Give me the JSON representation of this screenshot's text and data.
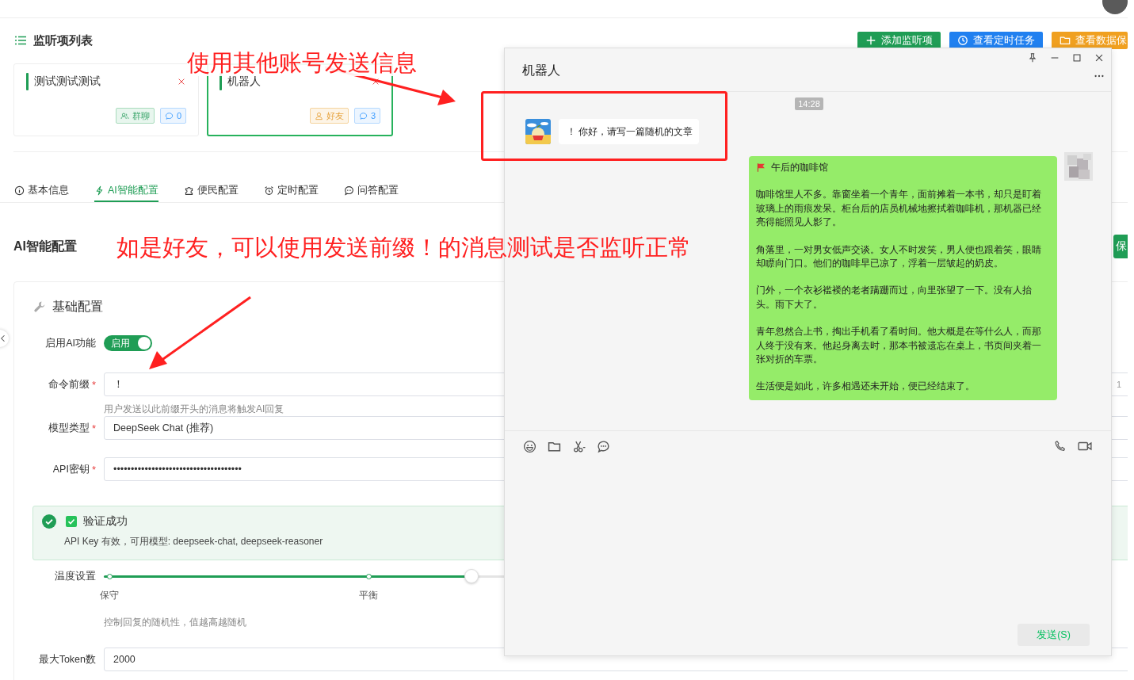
{
  "page": {
    "title": "监听项列表",
    "actions": [
      {
        "label": "添加监听项",
        "kind": "add"
      },
      {
        "label": "查看定时任务",
        "kind": "clock"
      },
      {
        "label": "查看数据保",
        "kind": "folder"
      }
    ],
    "monitor_items": [
      {
        "title": "测试测试测试",
        "selected": false,
        "kind": "group",
        "type_label": "群聊",
        "count": "0"
      },
      {
        "title": "机器人",
        "selected": true,
        "kind": "friend",
        "type_label": "好友",
        "count": "3"
      }
    ],
    "tabs": [
      {
        "label": "基本信息",
        "kind": "info",
        "selected": false
      },
      {
        "label": "AI智能配置",
        "kind": "bolt",
        "selected": true
      },
      {
        "label": "便民配置",
        "kind": "puzzle",
        "selected": false
      },
      {
        "label": "定时配置",
        "kind": "alarm",
        "selected": false
      },
      {
        "label": "问答配置",
        "kind": "chat",
        "selected": false
      }
    ],
    "section_title": "AI智能配置",
    "save_button": "保",
    "panel": {
      "title": "基础配置",
      "fields": [
        {
          "kind": "switch",
          "label": "启用AI功能",
          "on": true,
          "text": "启用"
        },
        {
          "kind": "input",
          "label": "命令前缀",
          "required": "*",
          "value": "！",
          "counter": "1",
          "help": "用户发送以此前缀开头的消息将触发AI回复"
        },
        {
          "kind": "select",
          "label": "模型类型",
          "required": "*",
          "value": "DeepSeek Chat (推荐)"
        },
        {
          "kind": "input",
          "label": "API密钥",
          "required": "*",
          "value": "•••••••••••••••••••••••••••••••••••••"
        },
        {
          "kind": "alert",
          "title": "验证成功",
          "checked": true,
          "message": "API Key 有效，可用模型: deepseek-chat, deepseek-reasoner"
        },
        {
          "kind": "slider",
          "label": "温度设置",
          "level": 0.365,
          "marks": [
            "保守",
            "平衡"
          ],
          "help": "控制回复的随机性，值越高越随机"
        },
        {
          "kind": "input",
          "label": "最大Token数",
          "value": "2000"
        }
      ]
    }
  },
  "chat_window": {
    "title": "机器人",
    "time": "14:28",
    "messages": [
      {
        "kind": "incoming",
        "text": "！ 你好，请写一篇随机的文章"
      },
      {
        "kind": "outgoing",
        "title": "午后的咖啡馆",
        "paragraphs": [
          "咖啡馆里人不多。靠窗坐着一个青年，面前摊着一本书，却只是盯着玻璃上的雨痕发呆。柜台后的店员机械地擦拭着咖啡机，那机器已经亮得能照见人影了。",
          "角落里，一对男女低声交谈。女人不时发笑，男人便也跟着笑，眼睛却瞟向门口。他们的咖啡早已凉了，浮着一层皱起的奶皮。",
          "门外，一个衣衫褴褛的老者蹒跚而过，向里张望了一下。没有人抬头。雨下大了。",
          "青年忽然合上书，掏出手机看了看时间。他大概是在等什么人，而那人终于没有来。他起身离去时，那本书被遗忘在桌上，书页间夹着一张对折的车票。",
          "生活便是如此，许多相遇还未开始，便已经结束了。"
        ]
      }
    ],
    "send_button": "发送(S)"
  },
  "annotations": [
    {
      "text": "使用其他账号发送信息"
    },
    {
      "text": "如是好友，可以使用发送前缀！的消息测试是否监听正常"
    }
  ]
}
